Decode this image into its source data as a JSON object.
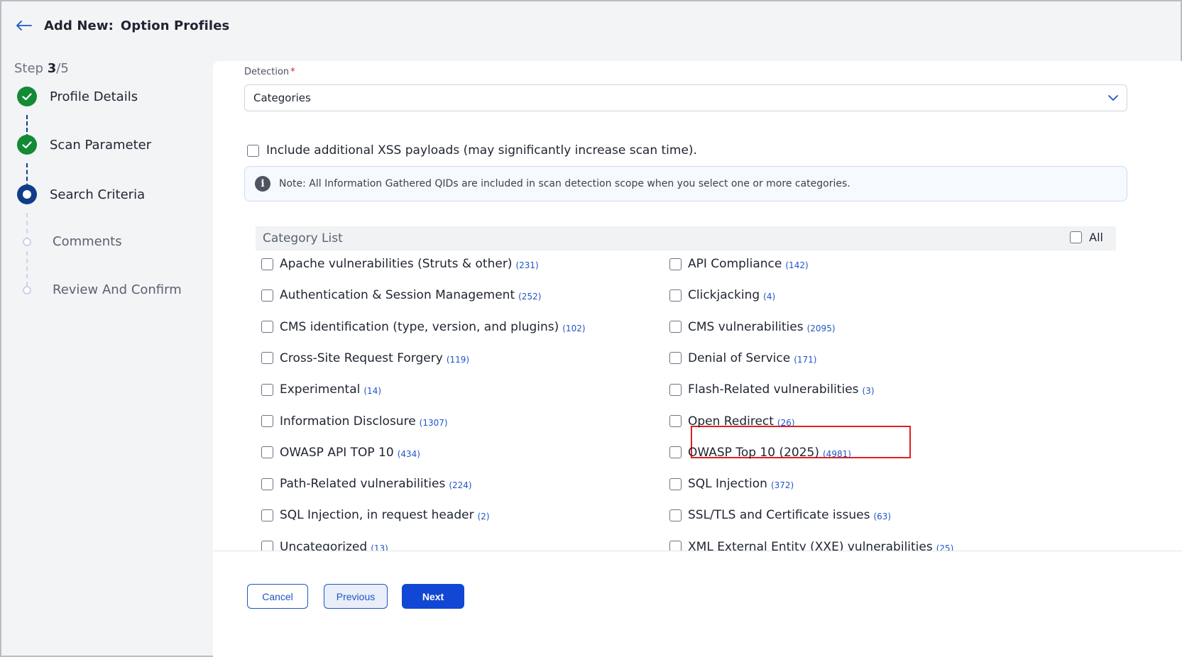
{
  "header": {
    "title_prefix": "Add New:",
    "title": "Option Profiles"
  },
  "stepper": {
    "label": "Step",
    "current": "3",
    "total": "/5",
    "steps": [
      {
        "label": "Profile Details",
        "state": "done"
      },
      {
        "label": "Scan Parameter",
        "state": "done"
      },
      {
        "label": "Search Criteria",
        "state": "current"
      },
      {
        "label": "Comments",
        "state": "todo"
      },
      {
        "label": "Review And Confirm",
        "state": "todo"
      }
    ]
  },
  "detection": {
    "label": "Detection",
    "required_mark": "*",
    "selected": "Categories"
  },
  "xss": {
    "label": "Include additional XSS payloads (may significantly increase scan time).",
    "checked": false
  },
  "note": {
    "icon": "info-icon",
    "text": "Note: All Information Gathered QIDs are included in scan detection scope when you select one or more categories."
  },
  "category_list": {
    "title": "Category List",
    "all_label": "All",
    "items": [
      {
        "name": "Apache vulnerabilities (Struts & other)",
        "count": "(231)"
      },
      {
        "name": "API Compliance",
        "count": "(142)"
      },
      {
        "name": "Authentication & Session Management",
        "count": "(252)"
      },
      {
        "name": "Clickjacking",
        "count": "(4)"
      },
      {
        "name": "CMS identification (type, version, and plugins)",
        "count": "(102)"
      },
      {
        "name": "CMS vulnerabilities",
        "count": "(2095)"
      },
      {
        "name": "Cross-Site Request Forgery",
        "count": "(119)"
      },
      {
        "name": "Denial of Service",
        "count": "(171)"
      },
      {
        "name": "Experimental",
        "count": "(14)"
      },
      {
        "name": "Flash-Related vulnerabilities",
        "count": "(3)"
      },
      {
        "name": "Information Disclosure",
        "count": "(1307)"
      },
      {
        "name": "Open Redirect",
        "count": "(26)"
      },
      {
        "name": "OWASP API TOP 10",
        "count": "(434)"
      },
      {
        "name": "OWASP Top 10 (2025)",
        "count": "(4981)"
      },
      {
        "name": "Path-Related vulnerabilities",
        "count": "(224)"
      },
      {
        "name": "SQL Injection",
        "count": "(372)"
      },
      {
        "name": "SQL Injection, in request header",
        "count": "(2)"
      },
      {
        "name": "SSL/TLS and Certificate issues",
        "count": "(63)"
      },
      {
        "name": "Uncategorized",
        "count": "(13)"
      },
      {
        "name": "XML External Entity (XXE) vulnerabilities",
        "count": "(25)"
      }
    ]
  },
  "buttons": {
    "cancel": "Cancel",
    "previous": "Previous",
    "next": "Next"
  },
  "colors": {
    "primary": "#1147d4",
    "done": "#138a36",
    "current_step": "#0f3d8a",
    "highlight": "#e02020",
    "count_link": "#1f55c5"
  }
}
